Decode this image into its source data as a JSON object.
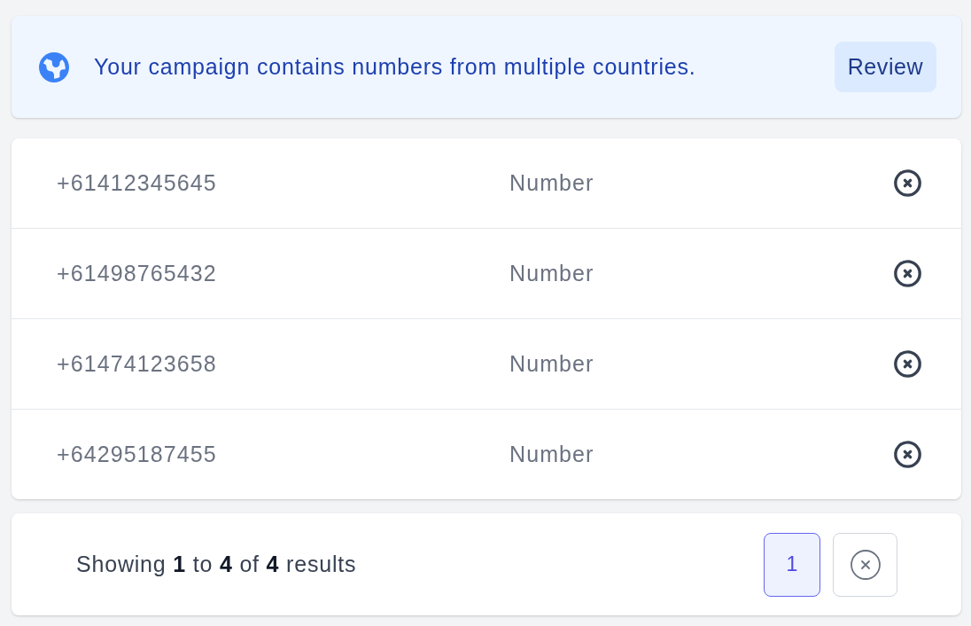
{
  "banner": {
    "message": "Your campaign contains numbers from multiple countries.",
    "button": "Review"
  },
  "numbers": {
    "rows": [
      {
        "number": "+61412345645",
        "type": "Number"
      },
      {
        "number": "+61498765432",
        "type": "Number"
      },
      {
        "number": "+61474123658",
        "type": "Number"
      },
      {
        "number": "+64295187455",
        "type": "Number"
      }
    ]
  },
  "pagination": {
    "summary": "Showing **1** to **4** of **4** results",
    "pages": [
      {
        "label": "1",
        "selected": true
      }
    ]
  }
}
